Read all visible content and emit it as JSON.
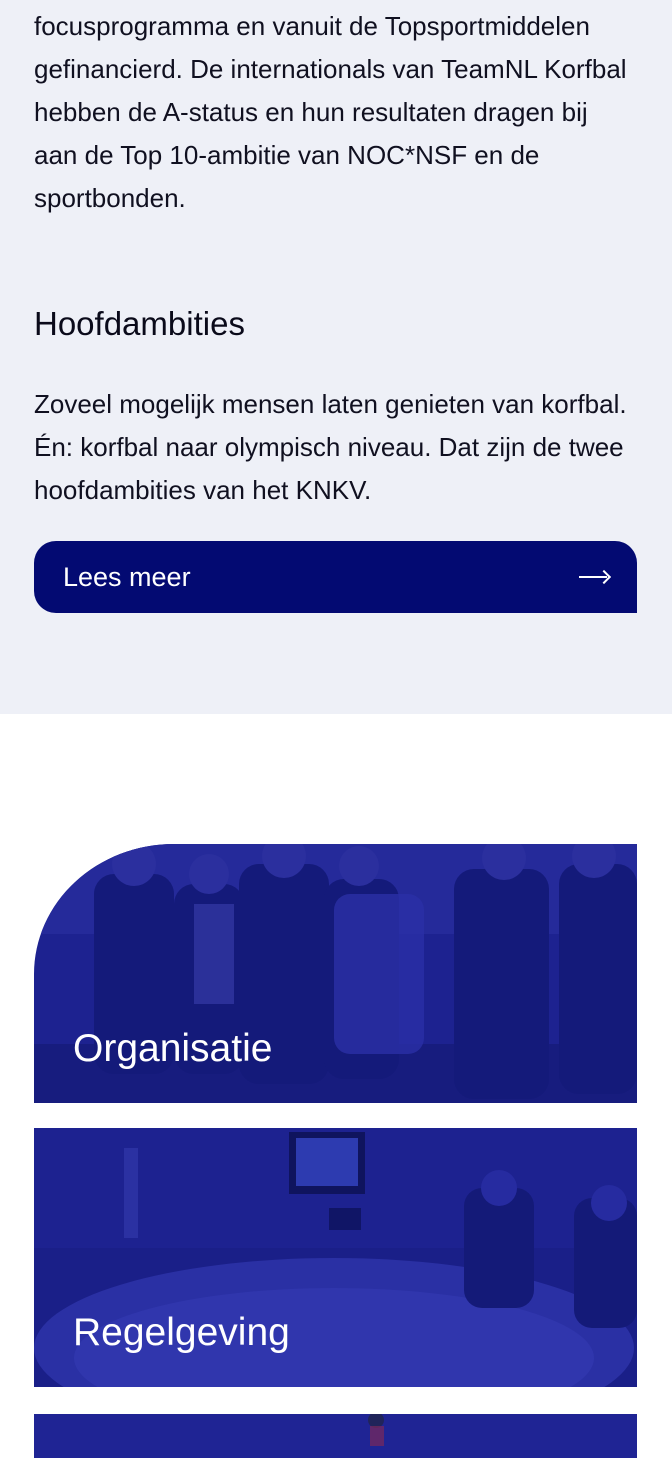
{
  "intro": {
    "paragraph_end": "focusprogramma en vanuit de Topsportmiddelen gefinancierd. De internationals van TeamNL Korfbal hebben de A-status en hun resultaten dragen bij aan de Top 10-ambitie van NOC*NSF en de sportbonden."
  },
  "ambitions": {
    "heading": "Hoofdambities",
    "text": "Zoveel mogelijk mensen laten genieten van korfbal. Én: korfbal naar olympisch niveau. Dat zijn de twee hoofdambities van het KNKV.",
    "button_label": "Lees meer",
    "button_icon": "arrow-right-icon"
  },
  "cards": [
    {
      "title": "Organisatie",
      "image": "group-photo"
    },
    {
      "title": "Regelgeving",
      "image": "meeting-room-photo"
    },
    {
      "title": "",
      "image": "sports-photo"
    }
  ],
  "colors": {
    "brand_navy": "#030a72",
    "section_bg": "#eef0f7",
    "card_overlay": "#1a1f8c"
  }
}
